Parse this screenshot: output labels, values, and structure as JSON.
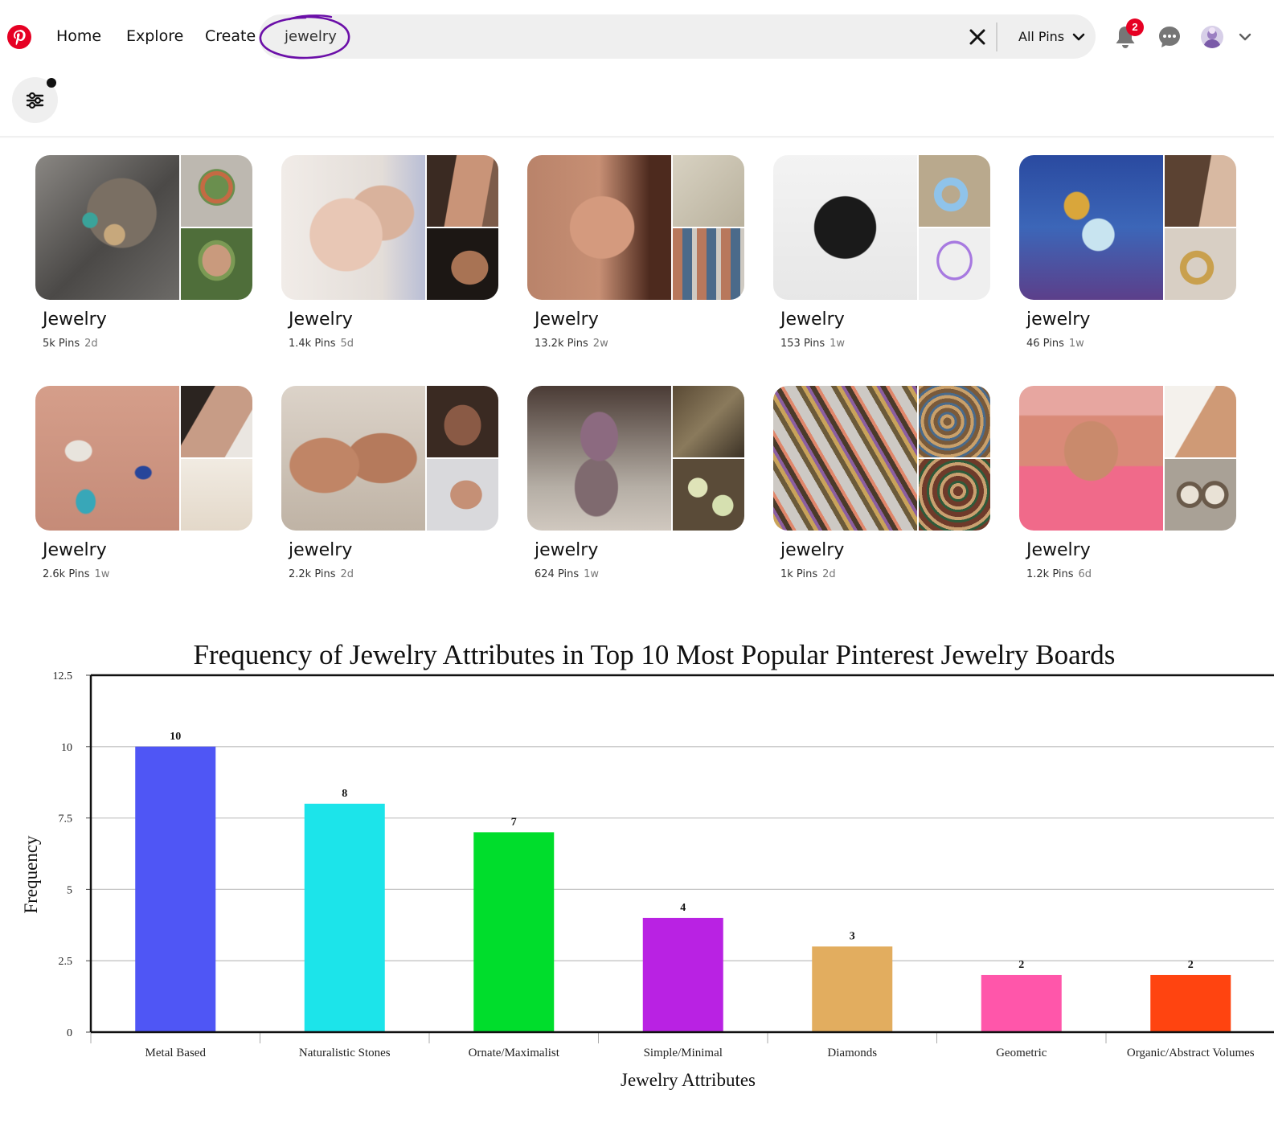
{
  "header": {
    "nav": [
      "Home",
      "Explore",
      "Create"
    ],
    "search_value": "jewelry",
    "scope_label": "All Pins",
    "notification_count": "2",
    "brand_color": "#e60023",
    "annotation_color": "#6b0fa8"
  },
  "boards": [
    {
      "title": "Jewelry",
      "pins": "5k Pins",
      "age": "2d"
    },
    {
      "title": "Jewelry",
      "pins": "1.4k Pins",
      "age": "5d"
    },
    {
      "title": "Jewelry",
      "pins": "13.2k Pins",
      "age": "2w"
    },
    {
      "title": "Jewelry",
      "pins": "153 Pins",
      "age": "1w"
    },
    {
      "title": "jewelry",
      "pins": "46 Pins",
      "age": "1w"
    },
    {
      "title": "Jewelry",
      "pins": "2.6k Pins",
      "age": "1w"
    },
    {
      "title": "jewelry",
      "pins": "2.2k Pins",
      "age": "2d"
    },
    {
      "title": "jewelry",
      "pins": "624 Pins",
      "age": "1w"
    },
    {
      "title": "jewelry",
      "pins": "1k Pins",
      "age": "2d"
    },
    {
      "title": "Jewelry",
      "pins": "1.2k Pins",
      "age": "6d"
    }
  ],
  "chart_data": {
    "type": "bar",
    "title": "Frequency of Jewelry Attributes in Top 10 Most Popular Pinterest Jewelry Boards",
    "xlabel": "Jewelry Attributes",
    "ylabel": "Frequency",
    "ylim": [
      0,
      12.5
    ],
    "yticks": [
      "0",
      "2.5",
      "5",
      "7.5",
      "10",
      "12.5"
    ],
    "grid": true,
    "categories": [
      "Metal Based",
      "Naturalistic Stones",
      "Ornate/Maximalist",
      "Simple/Minimal",
      "Diamonds",
      "Geometric",
      "Organic/Abstract Volumes"
    ],
    "values": [
      10,
      8,
      7,
      4,
      3,
      2,
      2
    ],
    "colors": [
      "#4f56f5",
      "#1ce4ea",
      "#00dd2c",
      "#b922e3",
      "#e2ad5f",
      "#ff56aa",
      "#ff4410"
    ]
  }
}
